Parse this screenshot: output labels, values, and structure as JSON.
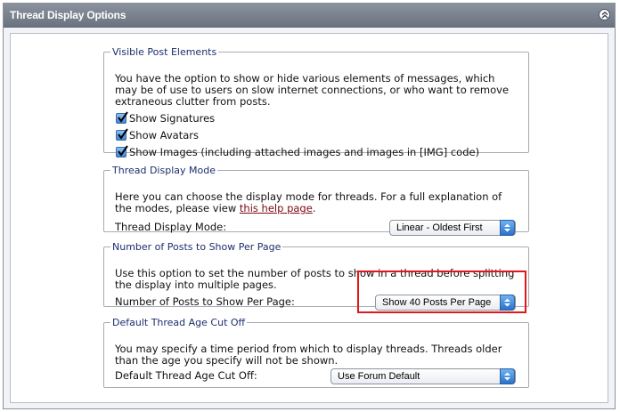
{
  "panel": {
    "title": "Thread Display Options",
    "collapse_icon": "collapse-up-icon"
  },
  "visible_post_elements": {
    "legend": "Visible Post Elements",
    "description_lines": [
      "You have the option to show or hide various elements of messages, which",
      "may be of use to users on slow internet connections, or who want to remove",
      "extraneous clutter from posts."
    ],
    "checkboxes": [
      {
        "label": "Show Signatures",
        "checked": true
      },
      {
        "label": "Show Avatars",
        "checked": true
      },
      {
        "label": "Show Images (including attached images and images in [IMG] code)",
        "checked": true
      }
    ]
  },
  "thread_display_mode": {
    "legend": "Thread Display Mode",
    "description_line1": "Here you can choose the display mode for threads. For a full explanation of",
    "description_line2_prefix": "the modes, please view ",
    "help_link": "this help page",
    "description_line2_suffix": ".",
    "field_label": "Thread Display Mode:",
    "selected": "Linear - Oldest First"
  },
  "posts_per_page": {
    "legend": "Number of Posts to Show Per Page",
    "description_lines": [
      "Use this option to set the number of posts to show in a thread before splitting",
      "the display into multiple pages."
    ],
    "field_label": "Number of Posts to Show Per Page:",
    "selected": "Show 40 Posts Per Page"
  },
  "age_cutoff": {
    "legend": "Default Thread Age Cut Off",
    "description_lines": [
      "You may specify a time period from which to display threads. Threads older",
      "than the age you specify will not be shown."
    ],
    "field_label": "Default Thread Age Cut Off:",
    "selected": "Use Forum Default"
  },
  "colors": {
    "titlebar": "#7b838f",
    "legend_text": "#1c2e6e",
    "link": "#7a0a12",
    "highlight": "#e0181b"
  }
}
